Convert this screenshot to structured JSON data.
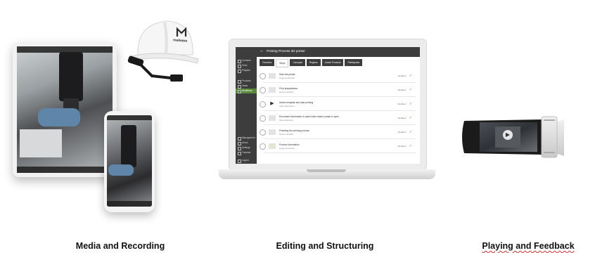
{
  "captions": {
    "media": "Media and Recording",
    "editing": "Editing and Structuring",
    "playing": "Playing and Feedback"
  },
  "laptop": {
    "page_title": "Printing Process 3D printer",
    "tabs": [
      "Overview",
      "Steps",
      "Concepts",
      "Regions",
      "Linked Products",
      "Participants"
    ],
    "sidebar": [
      "Contents",
      "Tests",
      "Playlists",
      "Products",
      "Tasks",
      "Workflows",
      "Management",
      "About",
      "Settings",
      "Tutorials",
      "Logout"
    ],
    "active_sidebar_index": 5,
    "steps": [
      {
        "title": "Start the printer",
        "sub": "Image description"
      },
      {
        "title": "Print preparations",
        "sub": "Device checklist"
      },
      {
        "title": "Select template and start printing",
        "sub": "Video description"
      },
      {
        "title": "Document information to sales when failure printer is open",
        "sub": "Task description"
      },
      {
        "title": "Finishing the printing process",
        "sub": "Device checklist"
      },
      {
        "title": "Product information",
        "sub": "Image description"
      }
    ],
    "step_status": "Modified"
  },
  "brand": "realware",
  "colors": {
    "accent": "#5a8a3a",
    "dark_ui": "#3d3d3d",
    "helmet": "#f6f6f6"
  },
  "icons": [
    "brand-logo-icon",
    "play-icon",
    "check-icon",
    "back-arrow-icon"
  ]
}
